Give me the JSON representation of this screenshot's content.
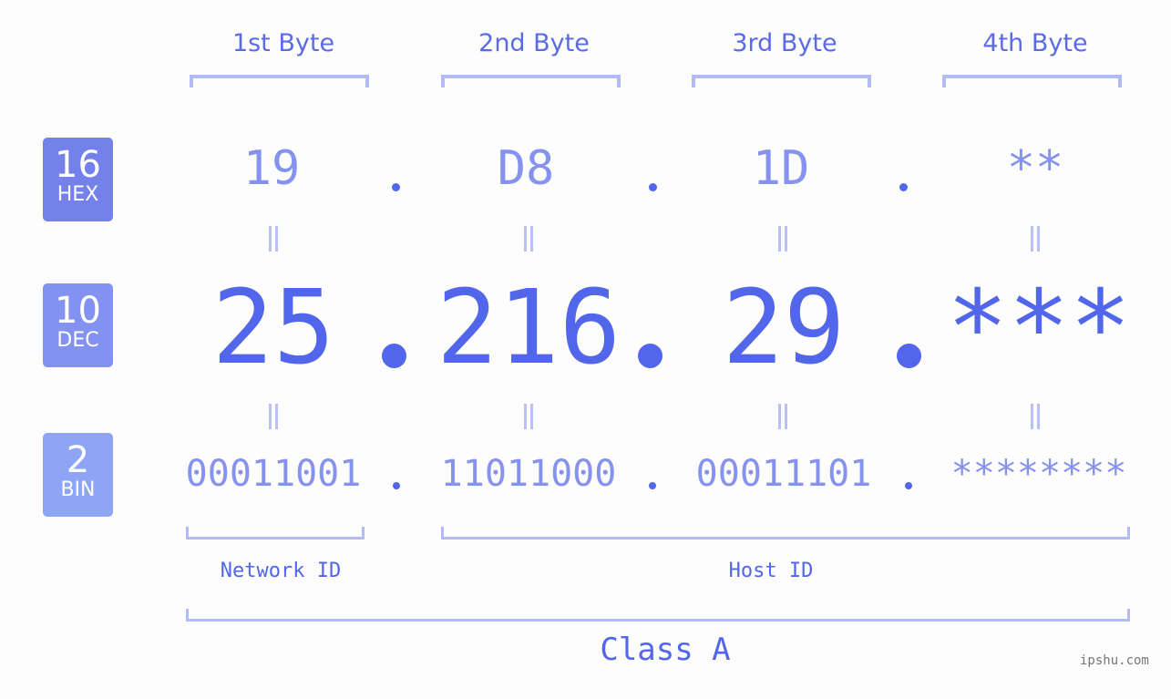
{
  "byte_headers": [
    "1st Byte",
    "2nd Byte",
    "3rd Byte",
    "4th Byte"
  ],
  "bases": [
    {
      "num": "16",
      "label": "HEX",
      "color": "#7581eb"
    },
    {
      "num": "10",
      "label": "DEC",
      "color": "#8392f0"
    },
    {
      "num": "2",
      "label": "BIN",
      "color": "#8ea5f6"
    }
  ],
  "hex": [
    "19",
    "D8",
    "1D",
    "**"
  ],
  "dec": [
    "25",
    "216",
    "29",
    "***"
  ],
  "bin": [
    "00011001",
    "11011000",
    "00011101",
    "********"
  ],
  "separator": ".",
  "equals": "=",
  "network_id_label": "Network ID",
  "host_id_label": "Host ID",
  "class_label": "Class A",
  "watermark": "ipshu.com",
  "colors": {
    "primary": "#5166ea",
    "light": "#8592ee",
    "bracket": "#b2baf8"
  }
}
